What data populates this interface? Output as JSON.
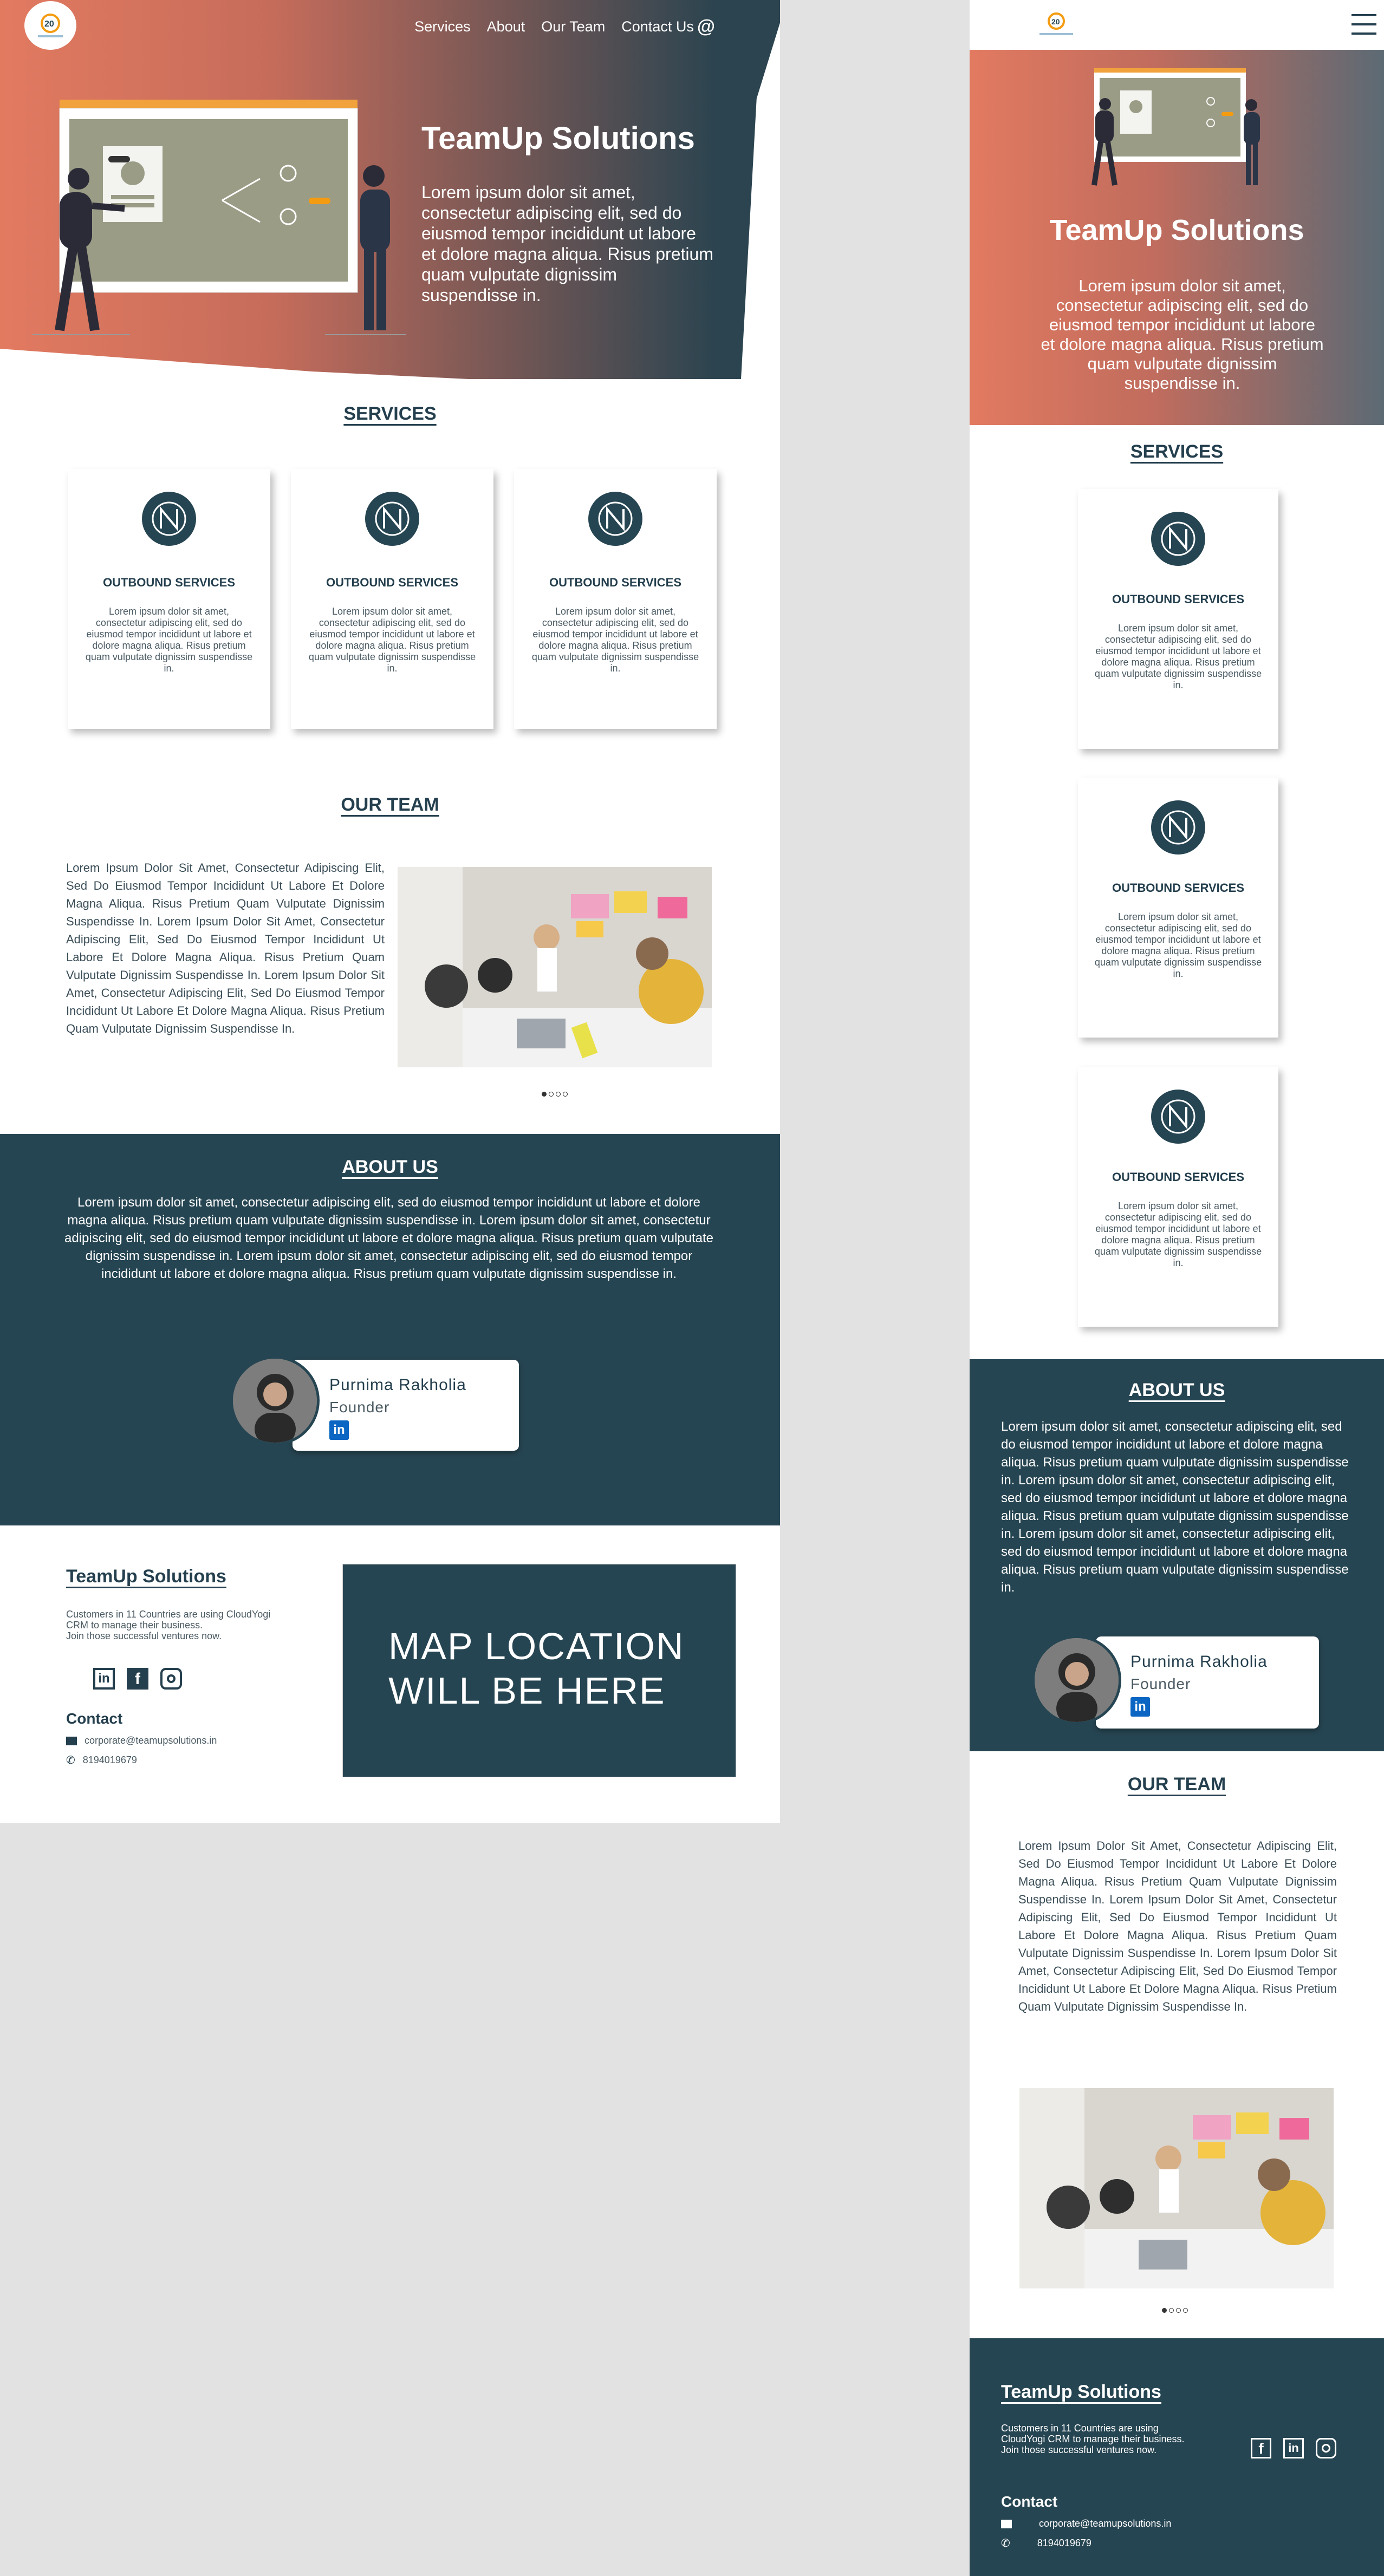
{
  "brand": "TeamUp Solutions",
  "nav": {
    "services": "Services",
    "about": "About",
    "team": "Our Team",
    "contact": "Contact Us",
    "contact_icon": "@"
  },
  "hero": {
    "title": "TeamUp Solutions",
    "text": "Lorem ipsum dolor sit amet, consectetur adipiscing elit, sed do eiusmod tempor incididunt ut labore et dolore magna aliqua. Risus pretium quam vulputate dignissim suspendisse in."
  },
  "services": {
    "title": "SERVICES",
    "cards": [
      {
        "title": "OUTBOUND SERVICES",
        "text": "Lorem ipsum dolor sit amet, consectetur adipiscing elit, sed do eiusmod tempor incididunt ut labore et dolore magna aliqua. Risus pretium quam vulputate dignissim suspendisse in."
      },
      {
        "title": "OUTBOUND SERVICES",
        "text": "Lorem ipsum dolor sit amet, consectetur adipiscing elit, sed do eiusmod tempor incididunt ut labore et dolore magna aliqua. Risus pretium quam vulputate dignissim suspendisse in."
      },
      {
        "title": "OUTBOUND SERVICES",
        "text": "Lorem ipsum dolor sit amet, consectetur adipiscing elit, sed do eiusmod tempor incididunt ut labore et dolore magna aliqua. Risus pretium quam vulputate dignissim suspendisse in."
      }
    ]
  },
  "team": {
    "title": "OUR TEAM",
    "text": "Lorem Ipsum Dolor Sit Amet, Consectetur Adipiscing Elit, Sed Do Eiusmod Tempor Incididunt Ut Labore Et Dolore Magna Aliqua. Risus Pretium Quam Vulputate Dignissim Suspendisse In. Lorem Ipsum Dolor Sit Amet, Consectetur Adipiscing Elit, Sed Do Eiusmod Tempor Incididunt Ut Labore Et Dolore Magna Aliqua. Risus Pretium Quam Vulputate Dignissim Suspendisse In. Lorem Ipsum Dolor Sit Amet, Consectetur Adipiscing Elit, Sed Do Eiusmod Tempor Incididunt Ut Labore Et Dolore Magna Aliqua. Risus Pretium Quam Vulputate Dignissim Suspendisse In."
  },
  "about": {
    "title": "ABOUT US",
    "text": "Lorem ipsum dolor sit amet, consectetur adipiscing elit, sed do eiusmod tempor incididunt ut labore et dolore magna aliqua. Risus pretium quam vulputate dignissim suspendisse in. Lorem ipsum dolor sit amet, consectetur adipiscing elit, sed do eiusmod tempor incididunt ut labore et dolore magna aliqua. Risus pretium quam vulputate dignissim suspendisse in. Lorem ipsum dolor sit amet, consectetur adipiscing elit, sed do eiusmod tempor incididunt ut labore et dolore magna aliqua. Risus pretium quam vulputate dignissim suspendisse in.",
    "member": {
      "name": "Purnima Rakholia",
      "role": "Founder",
      "linkedin": "in"
    }
  },
  "footer": {
    "title": "TeamUp Solutions",
    "desc": "Customers in 11 Countries are using CloudYogi CRM to manage their business.\nJoin those successful ventures now.",
    "contact_title": "Contact",
    "email": "corporate@teamupsolutions.in",
    "phone": "8194019679",
    "map": "MAP LOCATION WILL BE HERE"
  },
  "colors": {
    "dark": "#264552",
    "coral": "#e27a60",
    "accent": "#f39c12"
  }
}
